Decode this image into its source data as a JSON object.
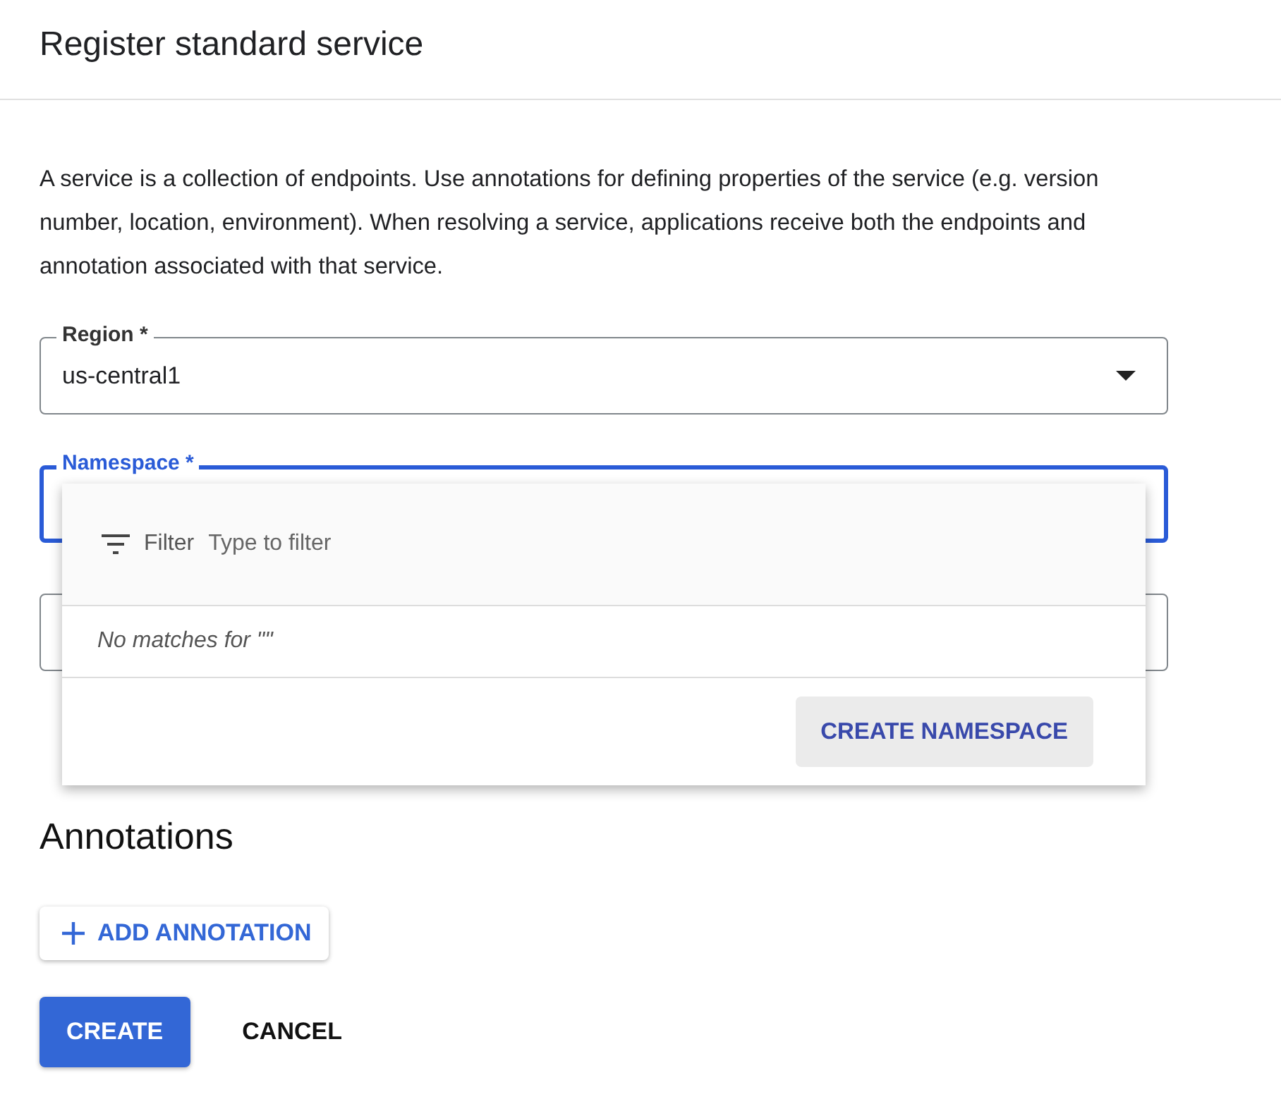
{
  "header": {
    "title": "Register standard service"
  },
  "description": "A service is a collection of endpoints. Use annotations for defining properties of the service (e.g. version number, location, environment). When resolving a service, applications receive both the endpoints and annotation associated with that service.",
  "fields": [
    {
      "kind": "select",
      "label": "Region *",
      "value": "us-central1",
      "focused": false
    },
    {
      "kind": "text",
      "label": "Namespace *",
      "focused": true
    },
    {
      "kind": "text",
      "focused": false
    }
  ],
  "dropdown": {
    "filter_label": "Filter",
    "placeholder": "Type to filter",
    "empty_message": "No matches for \"\"",
    "action": "CREATE NAMESPACE"
  },
  "annotations": {
    "heading": "Annotations",
    "add_button": "ADD ANNOTATION"
  },
  "buttons": [
    {
      "label": "CREATE",
      "kind": "primary"
    },
    {
      "label": "CANCEL",
      "kind": "text"
    }
  ]
}
